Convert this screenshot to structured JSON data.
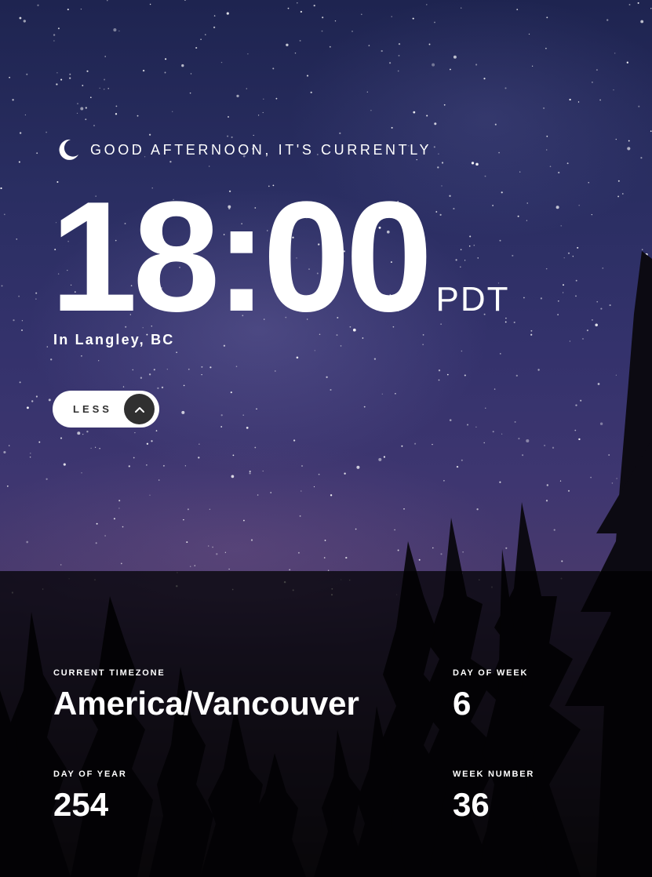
{
  "greeting": {
    "icon": "moon-icon",
    "text": "GOOD AFTERNOON, IT'S CURRENTLY"
  },
  "clock": {
    "time": "18:00",
    "timezone_abbr": "PDT",
    "location": "In Langley, BC"
  },
  "toggle_button": {
    "label": "LESS",
    "icon": "chevron-up-icon"
  },
  "details": {
    "current_timezone": {
      "label": "CURRENT TIMEZONE",
      "value": "America/Vancouver"
    },
    "day_of_week": {
      "label": "DAY OF WEEK",
      "value": "6"
    },
    "day_of_year": {
      "label": "DAY OF YEAR",
      "value": "254"
    },
    "week_number": {
      "label": "WEEK NUMBER",
      "value": "36"
    }
  },
  "colors": {
    "button_bg": "#ffffff",
    "button_text": "#303030",
    "circle_bg": "#303030",
    "panel_overlay": "rgba(0,0,0,0.72)"
  }
}
